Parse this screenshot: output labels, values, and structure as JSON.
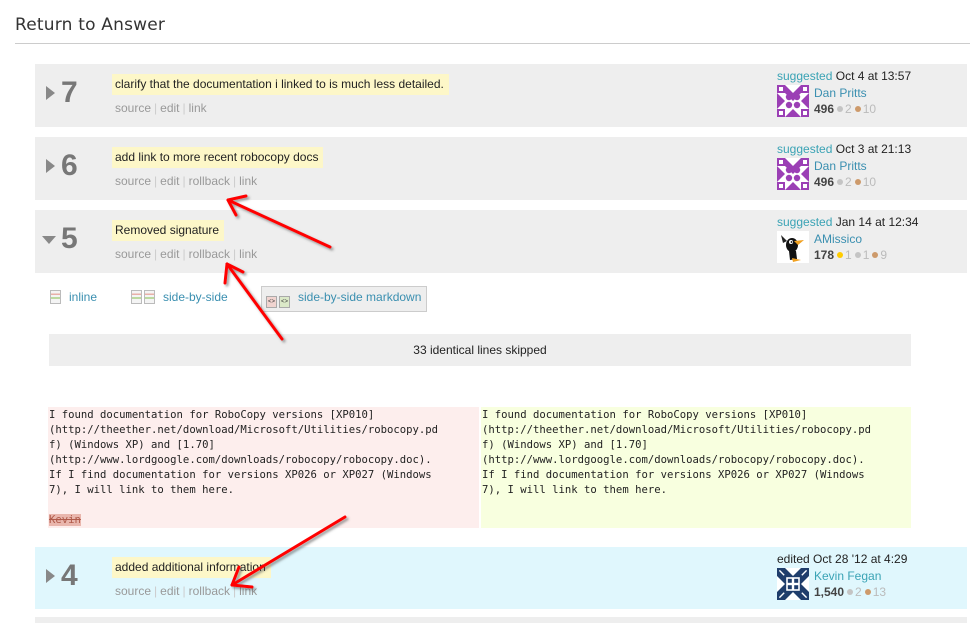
{
  "header": {
    "title": "Return to Answer"
  },
  "revisions": [
    {
      "number": "7",
      "state": "collapsed",
      "comment": "clarify that the documentation i linked to is much less detailed.",
      "links": [
        "source",
        "edit",
        "link"
      ],
      "action": "suggested",
      "timestamp": "Oct 4 at 13:57",
      "user": {
        "name": "Dan Pritts",
        "reputation": "496",
        "badges": {
          "silver": "2",
          "bronze": "10"
        },
        "avatar_color": "#9b3fb5"
      }
    },
    {
      "number": "6",
      "state": "collapsed",
      "comment": "add link to more recent robocopy docs",
      "links": [
        "source",
        "edit",
        "rollback",
        "link"
      ],
      "action": "suggested",
      "timestamp": "Oct 3 at 21:13",
      "user": {
        "name": "Dan Pritts",
        "reputation": "496",
        "badges": {
          "silver": "2",
          "bronze": "10"
        },
        "avatar_color": "#9b3fb5"
      }
    },
    {
      "number": "5",
      "state": "expanded",
      "comment": "Removed signature",
      "links": [
        "source",
        "edit",
        "rollback",
        "link"
      ],
      "action": "suggested",
      "timestamp": "Jan 14 at 12:34",
      "user": {
        "name": "AMissico",
        "reputation": "178",
        "badges": {
          "gold": "1",
          "silver": "1",
          "bronze": "9"
        }
      }
    },
    {
      "number": "4",
      "state": "collapsed",
      "comment": "added additional information",
      "links": [
        "source",
        "edit",
        "rollback",
        "link"
      ],
      "action": "edited",
      "timestamp": "Oct 28 '12 at 4:29",
      "user": {
        "name": "Kevin Fegan",
        "reputation": "1,540",
        "badges": {
          "silver": "2",
          "bronze": "13"
        },
        "avatar_color": "#1f3d6b"
      }
    }
  ],
  "view_options": [
    {
      "label": "inline",
      "active": false
    },
    {
      "label": "side-by-side",
      "active": false
    },
    {
      "label": "side-by-side markdown",
      "active": true
    }
  ],
  "diff": {
    "skipped": "33 identical lines skipped",
    "left_lines": [
      "I found documentation for RoboCopy versions [XP010]",
      "(http://theether.net/download/Microsoft/Utilities/robocopy.pd",
      "f) (Windows XP) and [1.70]",
      "(http://www.lordgoogle.com/downloads/robocopy/robocopy.doc).",
      "If I find documentation for versions XP026 or XP027 (Windows",
      "7), I will link to them here.",
      ""
    ],
    "left_deleted": "Kevin",
    "right_lines": [
      "I found documentation for RoboCopy versions [XP010]",
      "(http://theether.net/download/Microsoft/Utilities/robocopy.pd",
      "f) (Windows XP) and [1.70]",
      "(http://www.lordgoogle.com/downloads/robocopy/robocopy.doc).",
      "If I find documentation for versions XP026 or XP027 (Windows",
      "7), I will link to them here."
    ]
  },
  "annotation": {
    "arrow_color": "#ff0000"
  }
}
